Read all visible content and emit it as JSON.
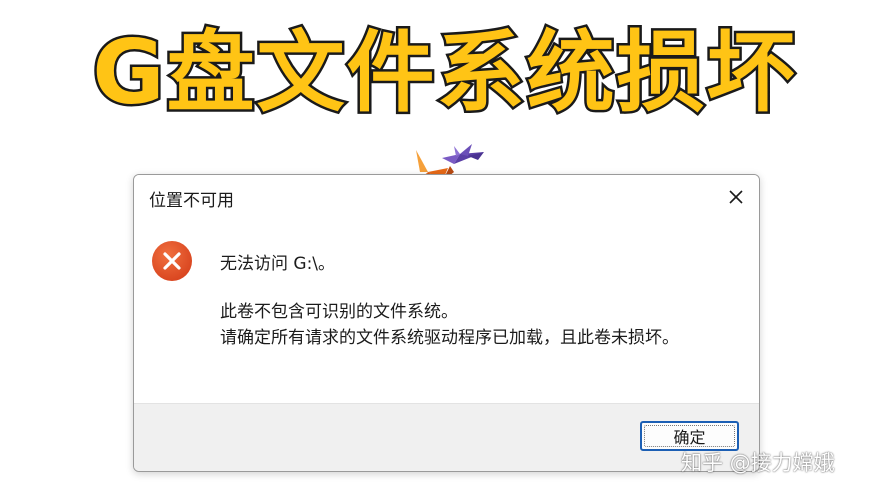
{
  "headline": "G盘文件系统损坏",
  "dialog": {
    "title": "位置不可用",
    "close_icon": "close-icon",
    "error_icon": "error-icon",
    "main_message": "无法访问 G:\\。",
    "detail_line1": "此卷不包含可识别的文件系统。",
    "detail_line2": "请确定所有请求的文件系统驱动程序已加载，且此卷未损坏。",
    "ok_label": "确定"
  },
  "watermark": "知乎 @接力嫦娥",
  "colors": {
    "headline_fill": "#ffc415",
    "headline_stroke": "#1a1a1a",
    "error_red": "#e2502a",
    "button_border": "#1c5fb4",
    "footer_bg": "#f0f0f0"
  }
}
